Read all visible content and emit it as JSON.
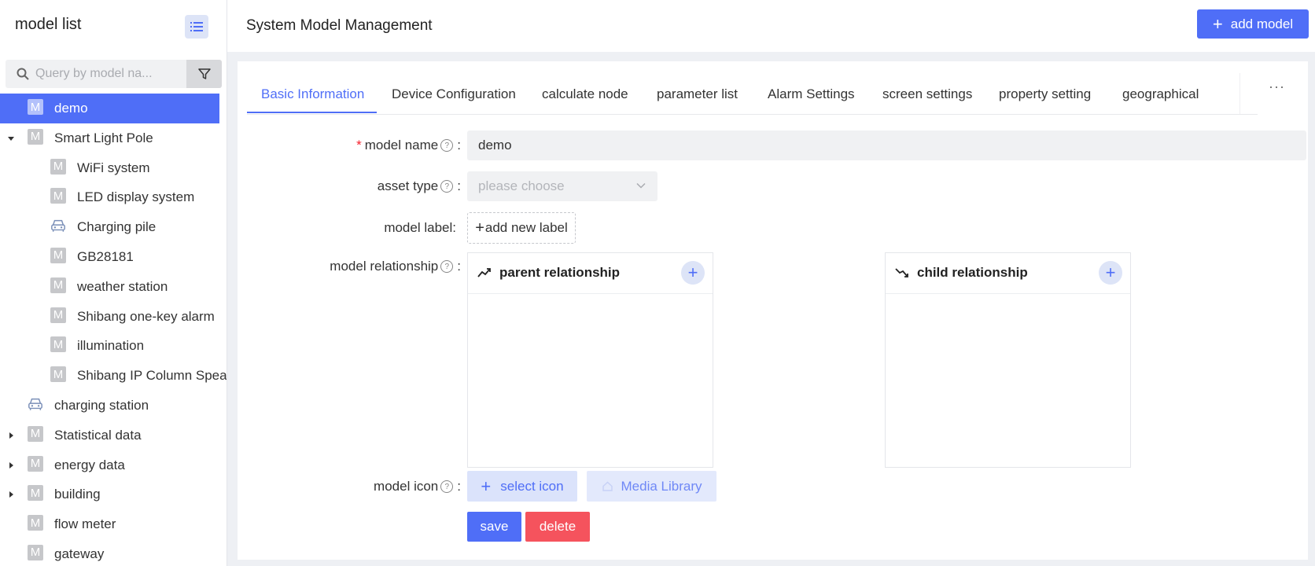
{
  "sidebar": {
    "title": "model list",
    "search_placeholder": "Query by model na...",
    "tree": [
      {
        "label": "demo",
        "icon": "M",
        "level": 0,
        "selected": true,
        "expandable": false
      },
      {
        "label": "Smart Light Pole",
        "icon": "M",
        "level": 0,
        "expanded": true,
        "expandable": true
      },
      {
        "label": "WiFi system",
        "icon": "M",
        "level": 1
      },
      {
        "label": "LED display system",
        "icon": "M",
        "level": 1
      },
      {
        "label": "Charging pile",
        "icon": "car-icon",
        "level": 1
      },
      {
        "label": "GB28181",
        "icon": "M",
        "level": 1
      },
      {
        "label": "weather station",
        "icon": "M",
        "level": 1
      },
      {
        "label": "Shibang one-key alarm",
        "icon": "M",
        "level": 1
      },
      {
        "label": "illumination",
        "icon": "M",
        "level": 1
      },
      {
        "label": "Shibang IP Column Spea",
        "icon": "M",
        "level": 1
      },
      {
        "label": "charging station",
        "icon": "car-icon",
        "level": 0
      },
      {
        "label": "Statistical data",
        "icon": "M",
        "level": 0,
        "expandable": true
      },
      {
        "label": "energy data",
        "icon": "M",
        "level": 0,
        "expandable": true
      },
      {
        "label": "building",
        "icon": "M",
        "level": 0,
        "expandable": true
      },
      {
        "label": "flow meter",
        "icon": "M",
        "level": 0
      },
      {
        "label": "gateway",
        "icon": "M",
        "level": 0
      }
    ]
  },
  "header": {
    "title": "System Model Management",
    "add_button": "add model"
  },
  "tabs": [
    {
      "label": "Basic Information",
      "active": true
    },
    {
      "label": "Device Configuration"
    },
    {
      "label": "calculate node"
    },
    {
      "label": "parameter list"
    },
    {
      "label": "Alarm Settings"
    },
    {
      "label": "screen settings"
    },
    {
      "label": "property setting"
    },
    {
      "label": "geographical"
    }
  ],
  "tabs_more": "···",
  "form": {
    "model_name_label": "model name",
    "model_name_value": "demo",
    "asset_type_label": "asset type",
    "asset_type_placeholder": "please choose",
    "model_label_label": "model label",
    "add_label_button": "add new label",
    "relationship_label": "model relationship",
    "parent_title": "parent relationship",
    "child_title": "child relationship",
    "model_icon_label": "model icon",
    "select_icon_button": "select icon",
    "media_library_button": "Media Library",
    "save_button": "save",
    "delete_button": "delete",
    "colon": ":"
  },
  "colors": {
    "primary": "#4f6ef7",
    "danger": "#f5535d",
    "required": "#f5222d"
  }
}
